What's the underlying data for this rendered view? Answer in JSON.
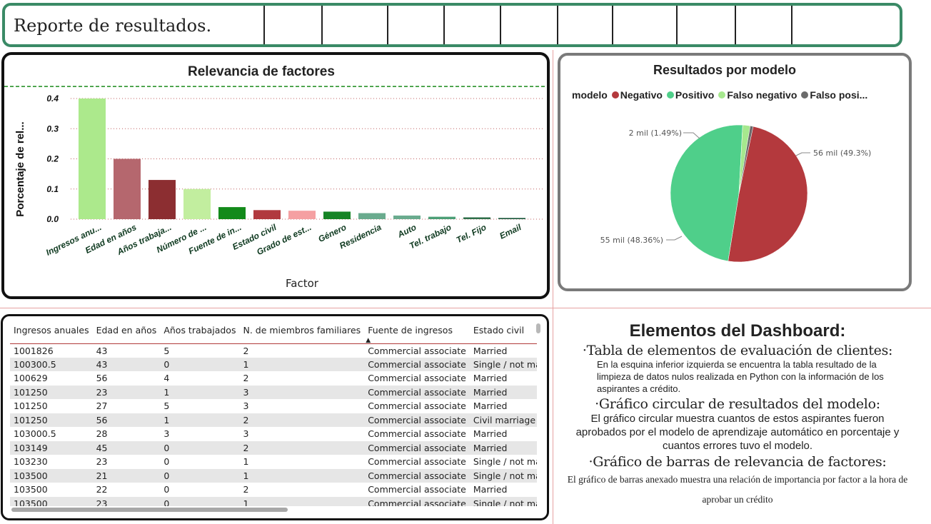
{
  "header": {
    "title": "Reporte de resultados."
  },
  "bar_chart": {
    "title": "Relevancia de factores",
    "ylabel": "Porcentaje de rel...",
    "xlabel": "Factor"
  },
  "pie_chart": {
    "title": "Resultados por modelo",
    "legend_title": "modelo",
    "legend_items": [
      {
        "label": "Negativo",
        "color": "#b4393d"
      },
      {
        "label": "Positivo",
        "color": "#4fcf8a"
      },
      {
        "label": "Falso negativo",
        "color": "#a6e88e"
      },
      {
        "label": "Falso posi...",
        "color": "#6b6b6b"
      }
    ],
    "labels": [
      "56 mil (49.3%)",
      "55 mil (48.36%)",
      "2 mil (1.49%)"
    ]
  },
  "chart_data": [
    {
      "type": "bar",
      "title": "Relevancia de factores",
      "xlabel": "Factor",
      "ylabel": "Porcentaje de rel...",
      "ylim": [
        0,
        0.4
      ],
      "yticks": [
        "0.0",
        "0.1",
        "0.2",
        "0.3",
        "0.4"
      ],
      "reference_line": 0.44,
      "categories": [
        "Ingresos anu...",
        "Edad en años",
        "Años trabaja...",
        "Número de ...",
        "Fuente de in...",
        "Estado civil",
        "Grado de est...",
        "Género",
        "Residencia",
        "Auto",
        "Tel. trabajo",
        "Tel. Fijo",
        "Email"
      ],
      "values": [
        0.4,
        0.2,
        0.13,
        0.1,
        0.04,
        0.03,
        0.028,
        0.025,
        0.02,
        0.012,
        0.008,
        0.006,
        0.004
      ],
      "colors": [
        "#ace98c",
        "#b5676e",
        "#8c2e31",
        "#c2ee9f",
        "#138a1a",
        "#b1393e",
        "#f5a0a2",
        "#168425",
        "#6aab8e",
        "#6aab8e",
        "#4c9e76",
        "#2f6f4a",
        "#1f5a3f"
      ]
    },
    {
      "type": "pie",
      "title": "Resultados por modelo",
      "categories": [
        "Negativo",
        "Positivo",
        "Falso negativo",
        "Falso posi..."
      ],
      "values": [
        56,
        55,
        2,
        0.8
      ],
      "percent": [
        49.3,
        48.36,
        1.49,
        0.85
      ],
      "colors": [
        "#b4393d",
        "#4fcf8a",
        "#a6e88e",
        "#6b6b6b"
      ]
    }
  ],
  "table": {
    "columns": [
      "Ingresos anuales",
      "Edad en años",
      "Años trabajados",
      "N. de miembros familiares",
      "Fuente de ingresos",
      "Estado civil"
    ],
    "rows": [
      [
        "1001826",
        "43",
        "5",
        "2",
        "Commercial associate",
        "Married"
      ],
      [
        "100300.5",
        "43",
        "0",
        "1",
        "Commercial associate",
        "Single / not married"
      ],
      [
        "100629",
        "56",
        "4",
        "2",
        "Commercial associate",
        "Married"
      ],
      [
        "101250",
        "23",
        "1",
        "3",
        "Commercial associate",
        "Married"
      ],
      [
        "101250",
        "27",
        "5",
        "3",
        "Commercial associate",
        "Married"
      ],
      [
        "101250",
        "56",
        "1",
        "2",
        "Commercial associate",
        "Civil marriage"
      ],
      [
        "103000.5",
        "28",
        "3",
        "3",
        "Commercial associate",
        "Married"
      ],
      [
        "103149",
        "45",
        "0",
        "2",
        "Commercial associate",
        "Married"
      ],
      [
        "103230",
        "23",
        "0",
        "1",
        "Commercial associate",
        "Single / not married"
      ],
      [
        "103500",
        "21",
        "0",
        "1",
        "Commercial associate",
        "Single / not married"
      ],
      [
        "103500",
        "22",
        "0",
        "2",
        "Commercial associate",
        "Married"
      ],
      [
        "103500",
        "23",
        "0",
        "1",
        "Commercial associate",
        "Single / not married"
      ]
    ]
  },
  "description": {
    "title": "Elementos del Dashboard:",
    "sections": [
      {
        "title": "Tabla de elementos de evaluación de clientes:",
        "body": "En la esquina inferior izquierda se encuentra la tabla resultado de la limpieza de datos nulos realizada en Python con la información de los aspirantes a crédito."
      },
      {
        "title": "Gráfico circular de resultados del modelo:",
        "body": "El gráfico circular muestra cuantos de estos aspirantes fueron aprobados por el modelo de aprendizaje automático en porcentaje y cuantos errores tuvo el modelo."
      },
      {
        "title": "Gráfico de barras de relevancia de factores:",
        "body": "El gráfico de barras anexado muestra una relación de importancia por factor a la hora de aprobar un crédito"
      }
    ]
  }
}
